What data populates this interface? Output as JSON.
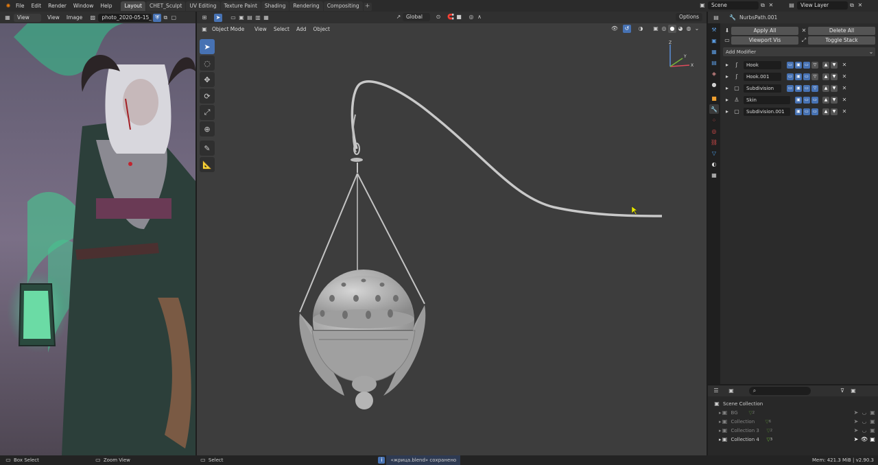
{
  "topbar": {
    "menus": [
      "File",
      "Edit",
      "Render",
      "Window",
      "Help"
    ],
    "tabs": [
      "Layout",
      "CHET_Sculpt",
      "UV Editing",
      "Texture Paint",
      "Shading",
      "Rendering",
      "Compositing"
    ],
    "active_tab": "Layout",
    "scene": "Scene",
    "view_layer": "View Layer"
  },
  "image_editor": {
    "view_label": "View",
    "menus": [
      "View",
      "Image"
    ],
    "image_name": "photo_2020-05-15_2..."
  },
  "viewport": {
    "mode": "Object Mode",
    "menus": [
      "View",
      "Select",
      "Add",
      "Object"
    ],
    "transform_orientation": "Global",
    "options_label": "Options",
    "axes": [
      "Z",
      "Y",
      "X"
    ]
  },
  "properties": {
    "object_name": "NurbsPath.001",
    "apply_all": "Apply All",
    "delete_all": "Delete All",
    "viewport_vis": "Viewport Vis",
    "toggle_stack": "Toggle Stack",
    "add_modifier": "Add Modifier",
    "modifiers": [
      {
        "name": "Hook"
      },
      {
        "name": "Hook.001"
      },
      {
        "name": "Subdivision"
      },
      {
        "name": "Skin"
      },
      {
        "name": "Subdivision.001"
      }
    ]
  },
  "outliner": {
    "root": "Scene Collection",
    "collections": [
      {
        "name": "BG",
        "count": "2"
      },
      {
        "name": "Collection",
        "count": "6"
      },
      {
        "name": "Collection 3",
        "count": "2"
      },
      {
        "name": "Collection 4",
        "count": "3"
      }
    ]
  },
  "status": {
    "box_select": "Box Select",
    "zoom_view": "Zoom View",
    "select": "Select",
    "message": "«жрица.blend» сохранено",
    "mem": "Mem: 421.3 MiB | v2.90.3"
  },
  "colors": {
    "accent": "#4772b3",
    "outline_green": "#6fbf3a"
  }
}
